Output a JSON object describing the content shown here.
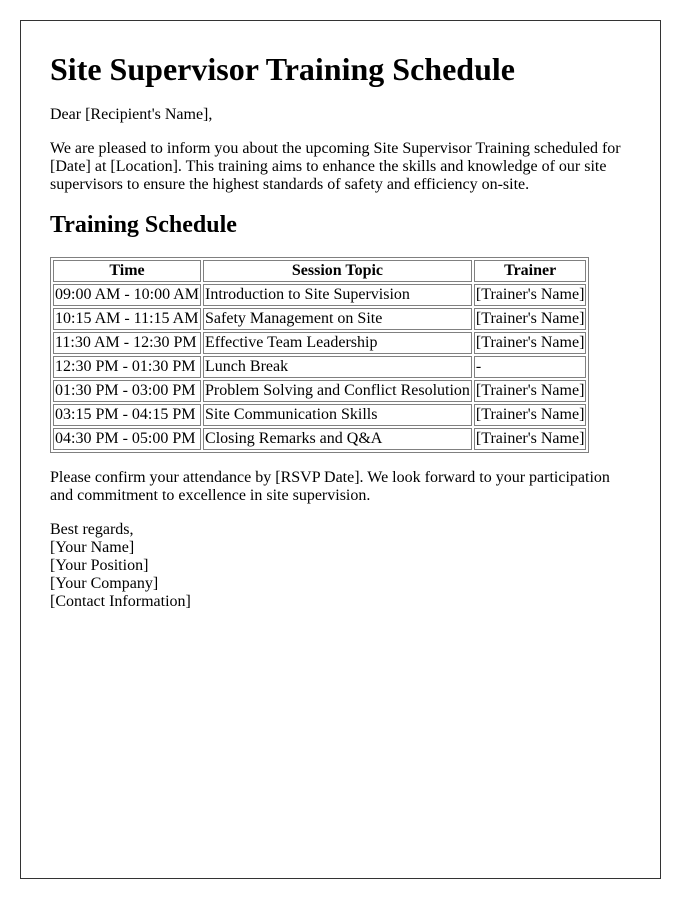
{
  "document": {
    "title": "Site Supervisor Training Schedule",
    "greeting": "Dear [Recipient's Name],",
    "intro": "We are pleased to inform you about the upcoming Site Supervisor Training scheduled for [Date] at [Location]. This training aims to enhance the skills and knowledge of our site supervisors to ensure the highest standards of safety and efficiency on-site.",
    "schedule_heading": "Training Schedule",
    "confirm": "Please confirm your attendance by [RSVP Date]. We look forward to your participation and commitment to excellence in site supervision.",
    "closing": {
      "sign_off": "Best regards,",
      "name": "[Your Name]",
      "position": "[Your Position]",
      "company": "[Your Company]",
      "contact": "[Contact Information]"
    }
  },
  "table": {
    "headers": [
      "Time",
      "Session Topic",
      "Trainer"
    ],
    "rows": [
      [
        "09:00 AM - 10:00 AM",
        "Introduction to Site Supervision",
        "[Trainer's Name]"
      ],
      [
        "10:15 AM - 11:15 AM",
        "Safety Management on Site",
        "[Trainer's Name]"
      ],
      [
        "11:30 AM - 12:30 PM",
        "Effective Team Leadership",
        "[Trainer's Name]"
      ],
      [
        "12:30 PM - 01:30 PM",
        "Lunch Break",
        "-"
      ],
      [
        "01:30 PM - 03:00 PM",
        "Problem Solving and Conflict Resolution",
        "[Trainer's Name]"
      ],
      [
        "03:15 PM - 04:15 PM",
        "Site Communication Skills",
        "[Trainer's Name]"
      ],
      [
        "04:30 PM - 05:00 PM",
        "Closing Remarks and Q&A",
        "[Trainer's Name]"
      ]
    ]
  }
}
